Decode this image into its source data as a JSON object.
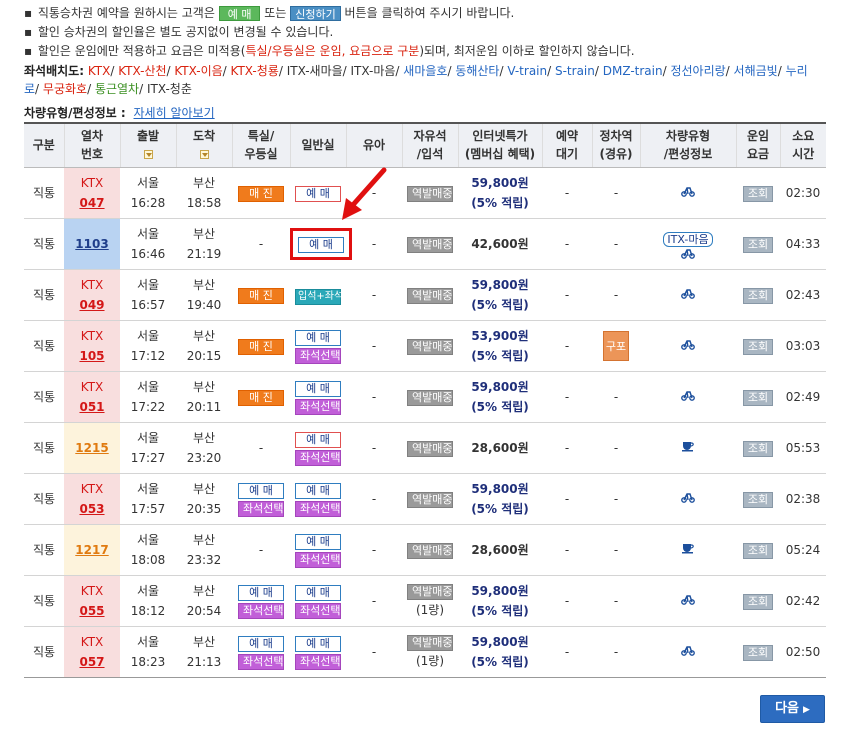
{
  "notices": {
    "line1_a": "직통승차권 예약을 원하시는 고객은",
    "line1_btn_reserve": "예 매",
    "line1_or": "또는",
    "line1_btn_apply": "신청하기",
    "line1_b": "버튼을 클릭하여 주시기 바랍니다.",
    "line2": "할인 승차권의 할인율은 별도 공지없이 변경될 수 있습니다.",
    "line3_a": "할인은 운임에만 적용하고 요금은 미적용(",
    "line3_red": "특실/우등실은 운임, 요금으로 구분",
    "line3_b": ")되며, 최저운임 이하로 할인하지 않습니다."
  },
  "seatmap": {
    "title": "좌석배치도:",
    "links": [
      {
        "label": "KTX",
        "color": "red"
      },
      {
        "label": "KTX-산천",
        "color": "red"
      },
      {
        "label": "KTX-이음",
        "color": "red"
      },
      {
        "label": "KTX-청룡",
        "color": "red"
      },
      {
        "label": "ITX-새마을",
        "color": "gray"
      },
      {
        "label": "ITX-마음",
        "color": "gray"
      },
      {
        "label": "새마을호",
        "color": "blue"
      },
      {
        "label": "동해산타",
        "color": "blue"
      },
      {
        "label": "V-train",
        "color": "blue"
      },
      {
        "label": "S-train",
        "color": "blue"
      },
      {
        "label": "DMZ-train",
        "color": "blue"
      },
      {
        "label": "정선아리랑",
        "color": "blue"
      },
      {
        "label": "서해금빛",
        "color": "blue"
      },
      {
        "label": "누리로",
        "color": "blue"
      },
      {
        "label": "무궁화호",
        "color": "red"
      },
      {
        "label": "통근열차",
        "color": "green"
      },
      {
        "label": "ITX-청춘",
        "color": "gray"
      }
    ]
  },
  "carinfo": {
    "title": "차량유형/편성정보 :",
    "link": "자세히 알아보기"
  },
  "table": {
    "headers": {
      "type": "구분",
      "train_no_1": "열차",
      "train_no_2": "번호",
      "depart": "출발",
      "arrive": "도착",
      "first_1": "특실/",
      "first_2": "우등실",
      "general": "일반실",
      "infant": "유아",
      "free_1": "자유석",
      "free_2": "/입석",
      "inet_1": "인터넷특가",
      "inet_2": "(멤버십 혜택)",
      "wait_1": "예약",
      "wait_2": "대기",
      "stop_1": "정차역",
      "stop_2": "(경유)",
      "car_1": "차량유형",
      "car_2": "/편성정보",
      "fare_1": "운임",
      "fare_2": "요금",
      "time_1": "소요",
      "time_2": "시간"
    },
    "rows": [
      {
        "kind": "직통",
        "train_type": "KTX",
        "train_no": "047",
        "style": "ktx",
        "dep_st": "서울",
        "dep_time": "16:28",
        "arr_st": "부산",
        "arr_time": "18:58",
        "first": "매 진",
        "general": "예 매",
        "infant": "-",
        "free": "역발매중",
        "free_sub": "",
        "price": "59,800원",
        "price_sub": "(5% 적립)",
        "wait": "-",
        "stop": "-",
        "car": "bike",
        "car_tag": "",
        "check": "조회",
        "duration": "02:30"
      },
      {
        "kind": "직통",
        "train_type": "",
        "train_no": "1103",
        "style": "itx",
        "dep_st": "서울",
        "dep_time": "16:46",
        "arr_st": "부산",
        "arr_time": "21:19",
        "first": "-",
        "general": "예 매",
        "infant": "-",
        "free": "역발매중",
        "free_sub": "",
        "price": "42,600원",
        "price_sub": "",
        "wait": "-",
        "stop": "-",
        "car": "bike",
        "car_tag": "ITX-마음",
        "check": "조회",
        "duration": "04:33"
      },
      {
        "kind": "직통",
        "train_type": "KTX",
        "train_no": "049",
        "style": "ktx",
        "dep_st": "서울",
        "dep_time": "16:57",
        "arr_st": "부산",
        "arr_time": "19:40",
        "first": "매 진",
        "general": "입석+좌석",
        "infant": "-",
        "free": "역발매중",
        "free_sub": "",
        "price": "59,800원",
        "price_sub": "(5% 적립)",
        "wait": "-",
        "stop": "-",
        "car": "bike",
        "car_tag": "",
        "check": "조회",
        "duration": "02:43"
      },
      {
        "kind": "직통",
        "train_type": "KTX",
        "train_no": "105",
        "style": "ktx",
        "dep_st": "서울",
        "dep_time": "17:12",
        "arr_st": "부산",
        "arr_time": "20:15",
        "first": "매 진",
        "general": "예 매",
        "general_seat": "좌석선택",
        "infant": "-",
        "free": "역발매중",
        "free_sub": "",
        "price": "53,900원",
        "price_sub": "(5% 적립)",
        "wait": "-",
        "stop": "구포",
        "car": "bike",
        "car_tag": "",
        "check": "조회",
        "duration": "03:03"
      },
      {
        "kind": "직통",
        "train_type": "KTX",
        "train_no": "051",
        "style": "ktx",
        "dep_st": "서울",
        "dep_time": "17:22",
        "arr_st": "부산",
        "arr_time": "20:11",
        "first": "매 진",
        "general": "예 매",
        "general_seat": "좌석선택",
        "infant": "-",
        "free": "역발매중",
        "free_sub": "",
        "price": "59,800원",
        "price_sub": "(5% 적립)",
        "wait": "-",
        "stop": "-",
        "car": "bike",
        "car_tag": "",
        "check": "조회",
        "duration": "02:49"
      },
      {
        "kind": "직통",
        "train_type": "",
        "train_no": "1215",
        "style": "mugung",
        "dep_st": "서울",
        "dep_time": "17:27",
        "arr_st": "부산",
        "arr_time": "23:20",
        "first": "-",
        "general": "예 매",
        "general_seat": "좌석선택",
        "infant": "-",
        "free": "역발매중",
        "free_sub": "",
        "price": "28,600원",
        "price_sub": "",
        "wait": "-",
        "stop": "-",
        "car": "cup",
        "car_tag": "",
        "check": "조회",
        "duration": "05:53"
      },
      {
        "kind": "직통",
        "train_type": "KTX",
        "train_no": "053",
        "style": "ktx",
        "dep_st": "서울",
        "dep_time": "17:57",
        "arr_st": "부산",
        "arr_time": "20:35",
        "first": "예 매",
        "first_seat": "좌석선택",
        "general": "예 매",
        "general_seat": "좌석선택",
        "infant": "-",
        "free": "역발매중",
        "free_sub": "",
        "price": "59,800원",
        "price_sub": "(5% 적립)",
        "wait": "-",
        "stop": "-",
        "car": "bike",
        "car_tag": "",
        "check": "조회",
        "duration": "02:38"
      },
      {
        "kind": "직통",
        "train_type": "",
        "train_no": "1217",
        "style": "mugung",
        "dep_st": "서울",
        "dep_time": "18:08",
        "arr_st": "부산",
        "arr_time": "23:32",
        "first": "-",
        "general": "예 매",
        "general_seat": "좌석선택",
        "infant": "-",
        "free": "역발매중",
        "free_sub": "",
        "price": "28,600원",
        "price_sub": "",
        "wait": "-",
        "stop": "-",
        "car": "cup",
        "car_tag": "",
        "check": "조회",
        "duration": "05:24"
      },
      {
        "kind": "직통",
        "train_type": "KTX",
        "train_no": "055",
        "style": "ktx",
        "dep_st": "서울",
        "dep_time": "18:12",
        "arr_st": "부산",
        "arr_time": "20:54",
        "first": "예 매",
        "first_seat": "좌석선택",
        "general": "예 매",
        "general_seat": "좌석선택",
        "infant": "-",
        "free": "역발매중",
        "free_sub": "(1량)",
        "price": "59,800원",
        "price_sub": "(5% 적립)",
        "wait": "-",
        "stop": "-",
        "car": "bike",
        "car_tag": "",
        "check": "조회",
        "duration": "02:42"
      },
      {
        "kind": "직통",
        "train_type": "KTX",
        "train_no": "057",
        "style": "ktx",
        "dep_st": "서울",
        "dep_time": "18:23",
        "arr_st": "부산",
        "arr_time": "21:13",
        "first": "예 매",
        "first_seat": "좌석선택",
        "general": "예 매",
        "general_seat": "좌석선택",
        "infant": "-",
        "free": "역발매중",
        "free_sub": "(1량)",
        "price": "59,800원",
        "price_sub": "(5% 적립)",
        "wait": "-",
        "stop": "-",
        "car": "bike",
        "car_tag": "",
        "check": "조회",
        "duration": "02:50"
      }
    ]
  },
  "next_button": "다음",
  "colors": {
    "ktx_bg": "#f8dede",
    "itx_bg": "#b9d3f2",
    "mugung_bg": "#fdf3dc",
    "sold_out": "#f07b1c",
    "seat_select": "#c15fd8",
    "next_btn": "#2d6cc0",
    "highlight": "#e01010"
  }
}
